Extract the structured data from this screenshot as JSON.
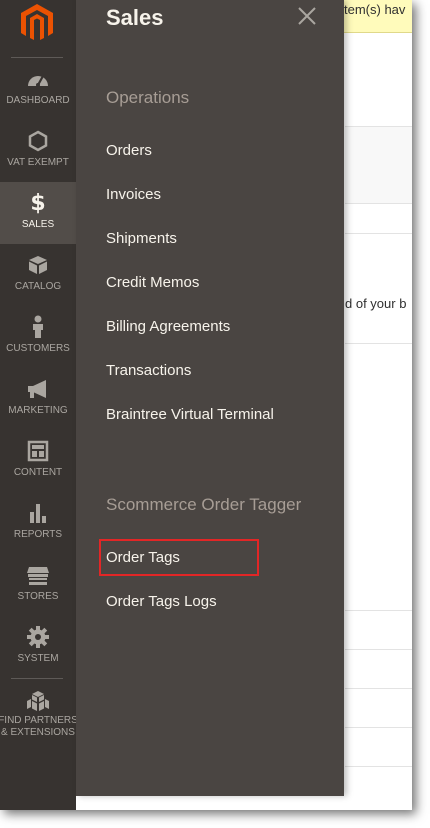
{
  "background": {
    "notice_text": "tem(s) hav",
    "snippet_text": "d of your b"
  },
  "nav": {
    "items": [
      {
        "label": "Dashboard",
        "icon": "dashboard-icon"
      },
      {
        "label": "Vat Exempt",
        "icon": "hexagon-icon"
      },
      {
        "label": "Sales",
        "icon": "dollar-icon",
        "glyph": "$"
      },
      {
        "label": "Catalog",
        "icon": "box-icon"
      },
      {
        "label": "Customers",
        "icon": "person-icon"
      },
      {
        "label": "Marketing",
        "icon": "megaphone-icon"
      },
      {
        "label": "Content",
        "icon": "layout-icon"
      },
      {
        "label": "Reports",
        "icon": "bar-chart-icon"
      },
      {
        "label": "Stores",
        "icon": "storefront-icon"
      },
      {
        "label": "System",
        "icon": "gear-icon"
      },
      {
        "label_line1": "Find Partners",
        "label_line2": "& Extensions",
        "icon": "cubes-icon"
      }
    ],
    "active": "Sales"
  },
  "flyout": {
    "title": "Sales",
    "close_icon": "close-icon",
    "sections": [
      {
        "heading": "Operations",
        "links": [
          "Orders",
          "Invoices",
          "Shipments",
          "Credit Memos",
          "Billing Agreements",
          "Transactions",
          "Braintree Virtual Terminal"
        ]
      },
      {
        "heading": "Scommerce Order Tagger",
        "links": [
          "Order Tags",
          "Order Tags Logs"
        ]
      }
    ],
    "highlighted_link": "Order Tags"
  },
  "colors": {
    "nav_bg": "#373330",
    "flyout_bg": "#4a4542",
    "active_bg": "#524d49",
    "logo": "#eb5202",
    "highlight_border": "#e22626"
  }
}
